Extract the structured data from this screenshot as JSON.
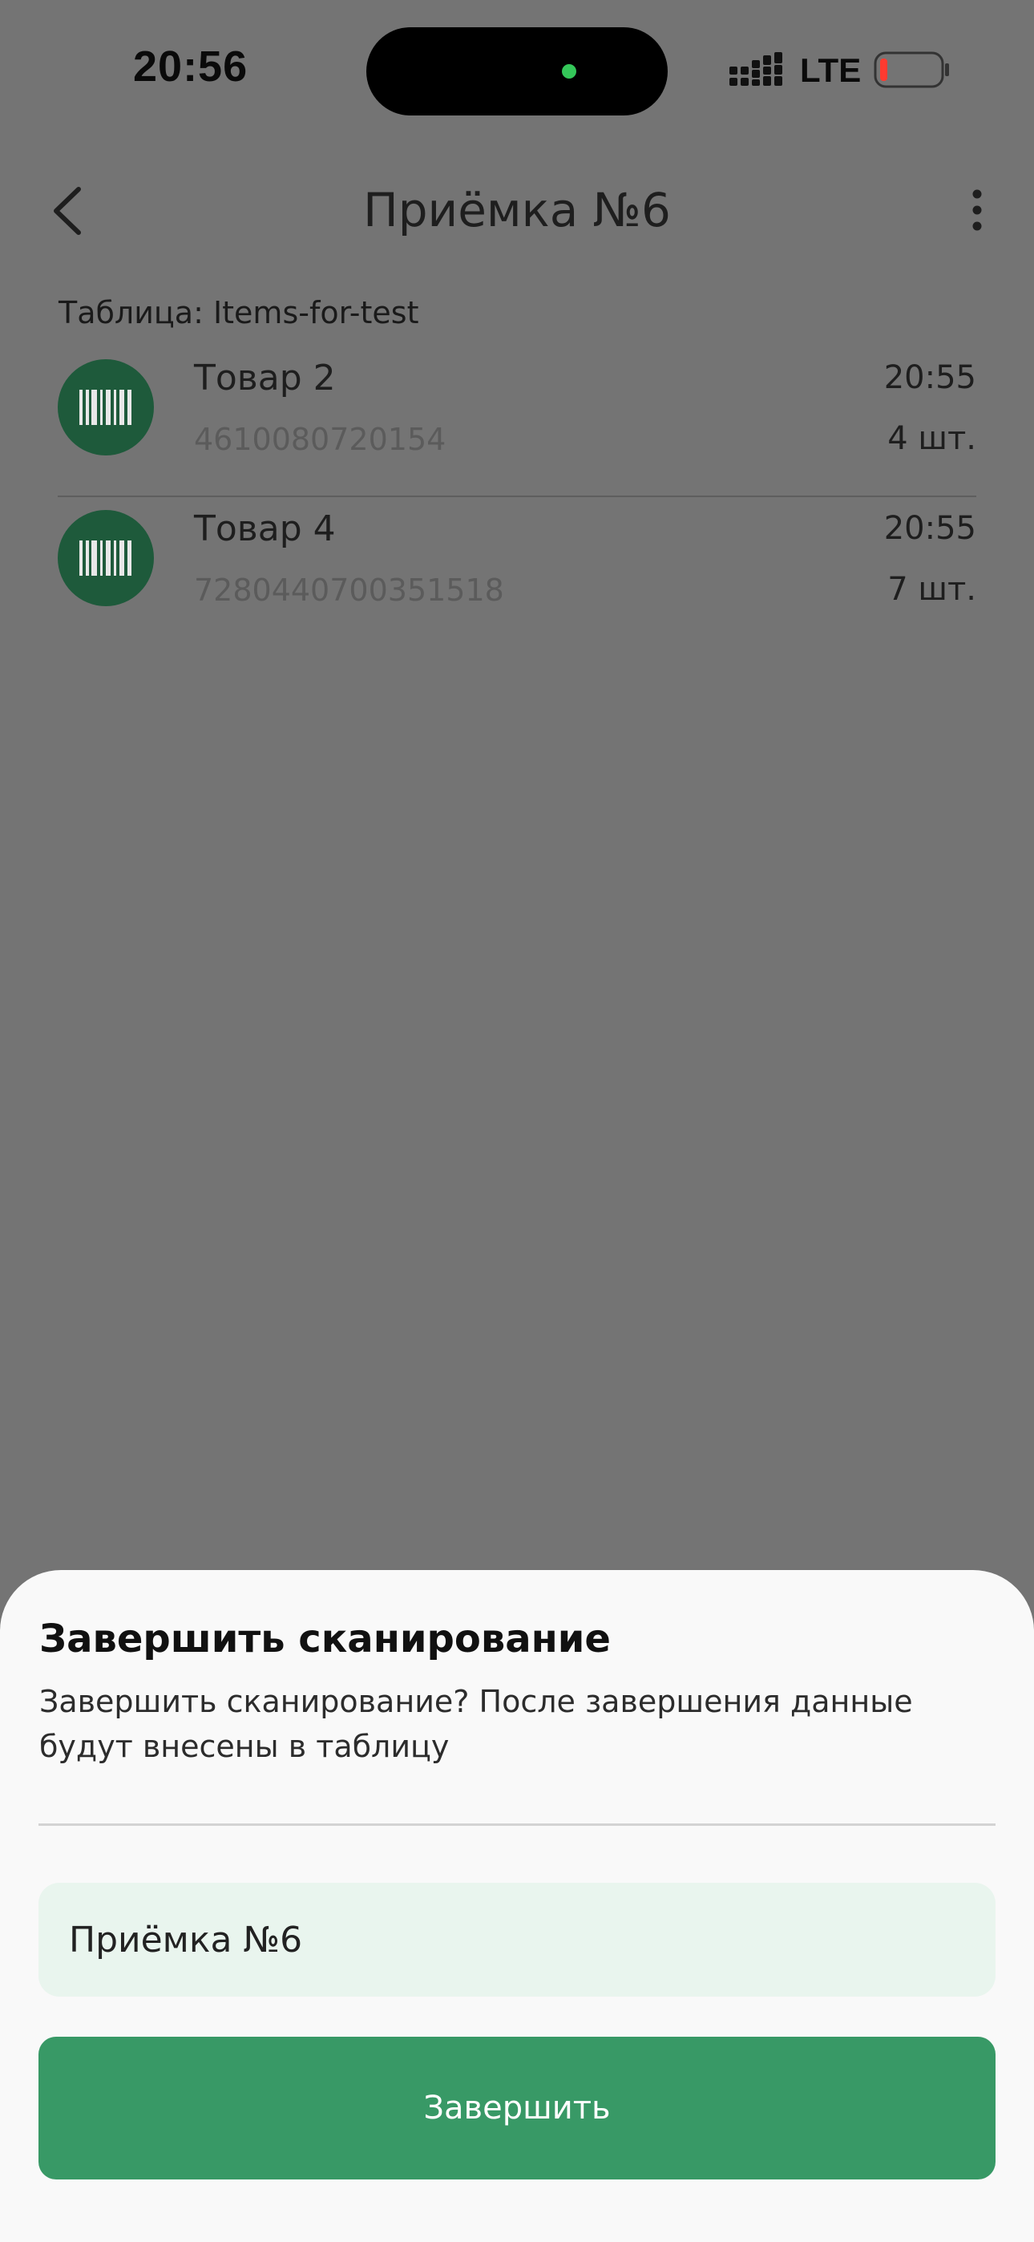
{
  "status_bar": {
    "time": "20:56",
    "network": "LTE"
  },
  "header": {
    "title": "Приёмка №6"
  },
  "table_label": "Таблица: Items-for-test",
  "items": [
    {
      "name": "Товар 2",
      "code": "4610080720154",
      "time": "20:55",
      "quantity": "4 шт."
    },
    {
      "name": "Товар 4",
      "code": "7280440700351518",
      "time": "20:55",
      "quantity": "7 шт."
    }
  ],
  "sheet": {
    "title": "Завершить сканирование",
    "message": "Завершить сканирование? После завершения данные будут внесены в таблицу",
    "name_value": "Приёмка №6",
    "finish_label": "Завершить"
  },
  "colors": {
    "overlay": "#747474",
    "accent": "#389966",
    "icon_bg": "#1e5a3b",
    "input_bg": "#e9f5ee",
    "battery_low": "#ff3b30"
  }
}
